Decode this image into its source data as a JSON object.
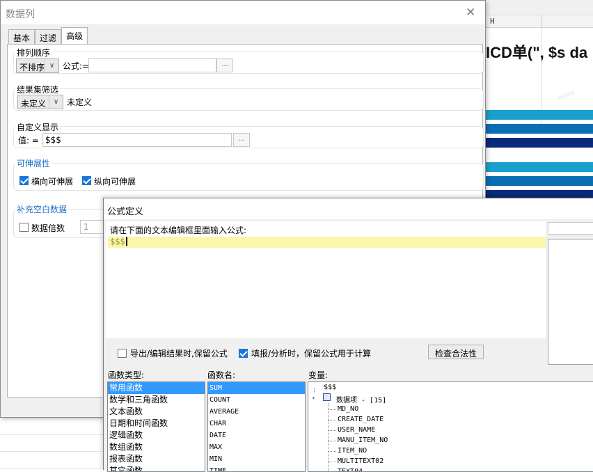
{
  "background": {
    "column_header": "H",
    "big_text": "ICD单(\", $s da",
    "bar_colors": [
      "#1aa0cc",
      "#0a6fb5",
      "#0a2b7a",
      "#1aa0cc",
      "#0a6fb5",
      "#0a2b7a"
    ]
  },
  "column_dialog": {
    "title": "数据列",
    "tabs": [
      "基本",
      "过滤",
      "高级"
    ],
    "active_tab": "高级",
    "sort": {
      "group_title": "排列顺序",
      "selected": "不排序",
      "formula_label": "公式:=",
      "formula_value": "",
      "dots": "..."
    },
    "filter": {
      "group_title": "结果集筛选",
      "selected": "未定义",
      "side_text": "未定义"
    },
    "custom_display": {
      "group_title": "自定义显示",
      "value_label": "值:  =",
      "value": "$$$",
      "dots": "..."
    },
    "stretch": {
      "group_title": "可伸展性",
      "horizontal_label": "横向可伸展",
      "horizontal_checked": true,
      "vertical_label": "纵向可伸展",
      "vertical_checked": true
    },
    "padding": {
      "group_title": "补充空白数据",
      "multiple_label": "数据倍数",
      "multiple_checked": false,
      "multiple_value": "1"
    }
  },
  "formula_dialog": {
    "title": "公式定义",
    "hint": "请在下面的文本编辑框里面输入公式:",
    "formula": "$$$",
    "keep_on_export_label": "导出/编辑结果时,保留公式",
    "keep_on_export_checked": false,
    "keep_on_fill_label": "填报/分析时，保留公式用于计算",
    "keep_on_fill_checked": true,
    "check_button": "检查合法性",
    "func_type_label": "函数类型:",
    "func_types": [
      "常用函数",
      "数学和三角函数",
      "文本函数",
      "日期和时间函数",
      "逻辑函数",
      "数组函数",
      "报表函数",
      "其它函数"
    ],
    "func_type_selected": "常用函数",
    "func_name_label": "函数名:",
    "func_names": [
      "SUM",
      "COUNT",
      "AVERAGE",
      "CHAR",
      "DATE",
      "MAX",
      "MIN",
      "TIME"
    ],
    "func_name_selected": "SUM",
    "var_label": "变量:",
    "var_root": "$$$",
    "var_group": "数据项 - [15]",
    "var_items": [
      "MD_NO",
      "CREATE_DATE",
      "USER_NAME",
      "MANU_ITEM_NO",
      "ITEM_NO",
      "MULTITEXT02",
      "TEXT04"
    ]
  }
}
